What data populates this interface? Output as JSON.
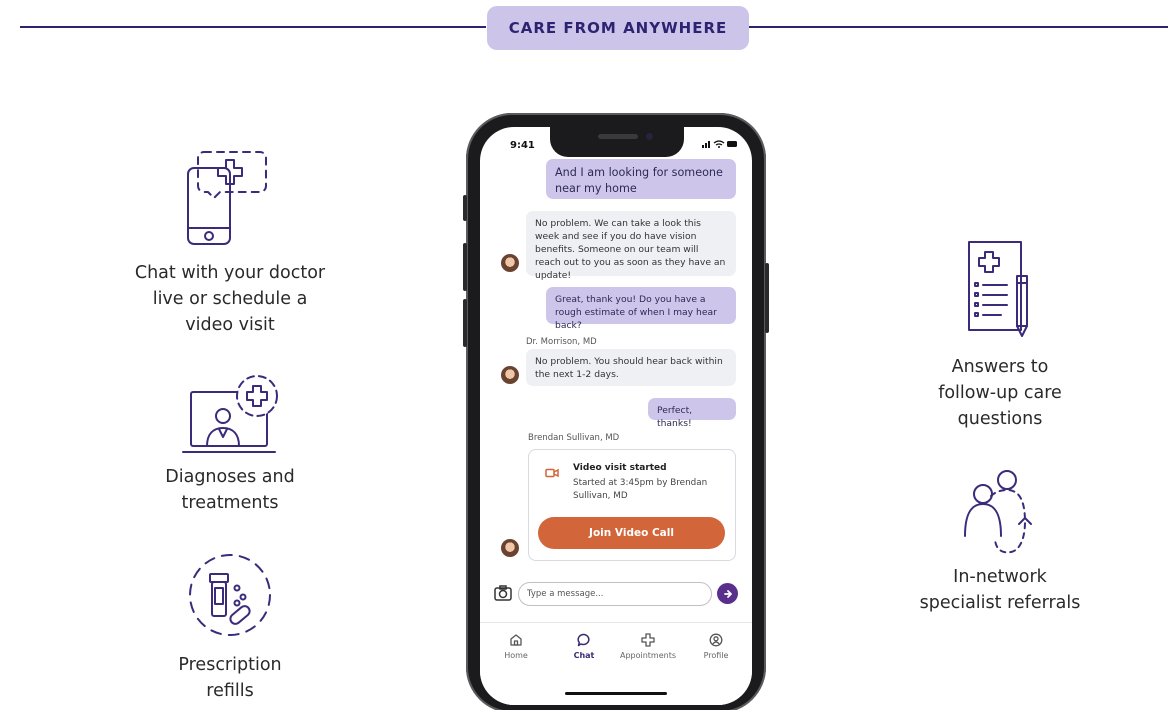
{
  "banner": {
    "title": "CARE FROM ANYWHERE"
  },
  "features_left": [
    {
      "icon": "phone-chat-icon",
      "text": "Chat with your doctor\nlive or schedule a\nvideo visit"
    },
    {
      "icon": "laptop-doctor-icon",
      "text": "Diagnoses and\ntreatments"
    },
    {
      "icon": "pill-bottle-icon",
      "text": "Prescription\nrefills"
    }
  ],
  "features_right": [
    {
      "icon": "clipboard-icon",
      "text": "Answers to\nfollow-up care\nquestions"
    },
    {
      "icon": "referral-people-icon",
      "text": "In-network\nspecialist referrals"
    }
  ],
  "phone": {
    "status_time": "9:41",
    "messages": [
      {
        "from": "me",
        "text": "And I am looking for someone near my home"
      },
      {
        "from": "doctor",
        "text": "No problem. We can take a look this week and see if you do have vision benefits. Someone on our team will reach out to you as soon as they have an update!"
      },
      {
        "from": "me",
        "text": "Great, thank you! Do you have a rough estimate of when I may hear back?"
      },
      {
        "from": "doctor",
        "sender": "Dr. Morrison, MD",
        "text": "No problem. You should hear back within the next 1-2 days."
      },
      {
        "from": "me",
        "text": "Perfect, thanks!"
      }
    ],
    "video_card": {
      "sender": "Brendan Sullivan, MD",
      "title": "Video visit started",
      "subtitle": "Started at 3:45pm by Brendan Sullivan, MD",
      "button": "Join Video Call"
    },
    "composer": {
      "placeholder": "Type a message..."
    },
    "tabs": [
      {
        "label": "Home",
        "icon": "home-icon",
        "active": false
      },
      {
        "label": "Chat",
        "icon": "chat-icon",
        "active": true
      },
      {
        "label": "Appointments",
        "icon": "plus-cross-icon",
        "active": false
      },
      {
        "label": "Profile",
        "icon": "profile-icon",
        "active": false
      }
    ]
  },
  "colors": {
    "brand_navy": "#2c2470",
    "banner_bg": "#cdc4ea",
    "bubble_out": "#cec5ea",
    "bubble_in": "#eef0f4",
    "join_button": "#d2653a",
    "send_button": "#5a2f8c",
    "icon_stroke": "#3b2b7a"
  }
}
